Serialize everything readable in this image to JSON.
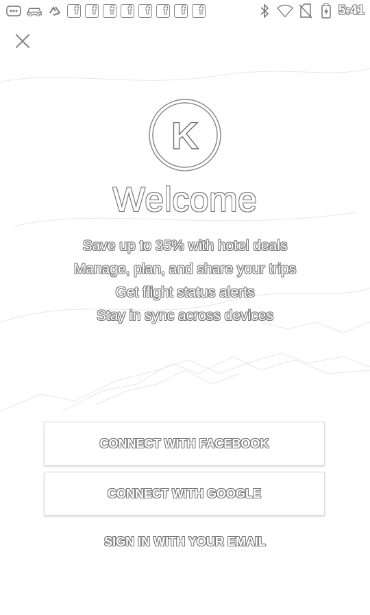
{
  "status_bar": {
    "fb_glyph": "f",
    "notification_icons": [
      "message-icon",
      "car-icon",
      "recycle-icon",
      "facebook-icon",
      "facebook-icon",
      "facebook-icon",
      "facebook-icon",
      "facebook-icon",
      "facebook-icon",
      "facebook-icon",
      "facebook-icon"
    ],
    "status_icons": [
      "bluetooth-icon",
      "wifi-icon",
      "no-sim-icon",
      "battery-icon"
    ],
    "time": "5:41"
  },
  "logo": {
    "letter": "K"
  },
  "welcome": {
    "title": "Welcome",
    "features": [
      "Save up to 35% with hotel deals",
      "Manage, plan, and share your trips",
      "Get flight status alerts",
      "Stay in sync across devices"
    ]
  },
  "actions": {
    "facebook_label": "CONNECT WITH FACEBOOK",
    "google_label": "CONNECT WITH GOOGLE",
    "email_label": "SIGN IN WITH YOUR EMAIL"
  },
  "colors": {
    "outline": "#7a7a7a",
    "fill": "#ffffff",
    "background": "#ffffff"
  }
}
